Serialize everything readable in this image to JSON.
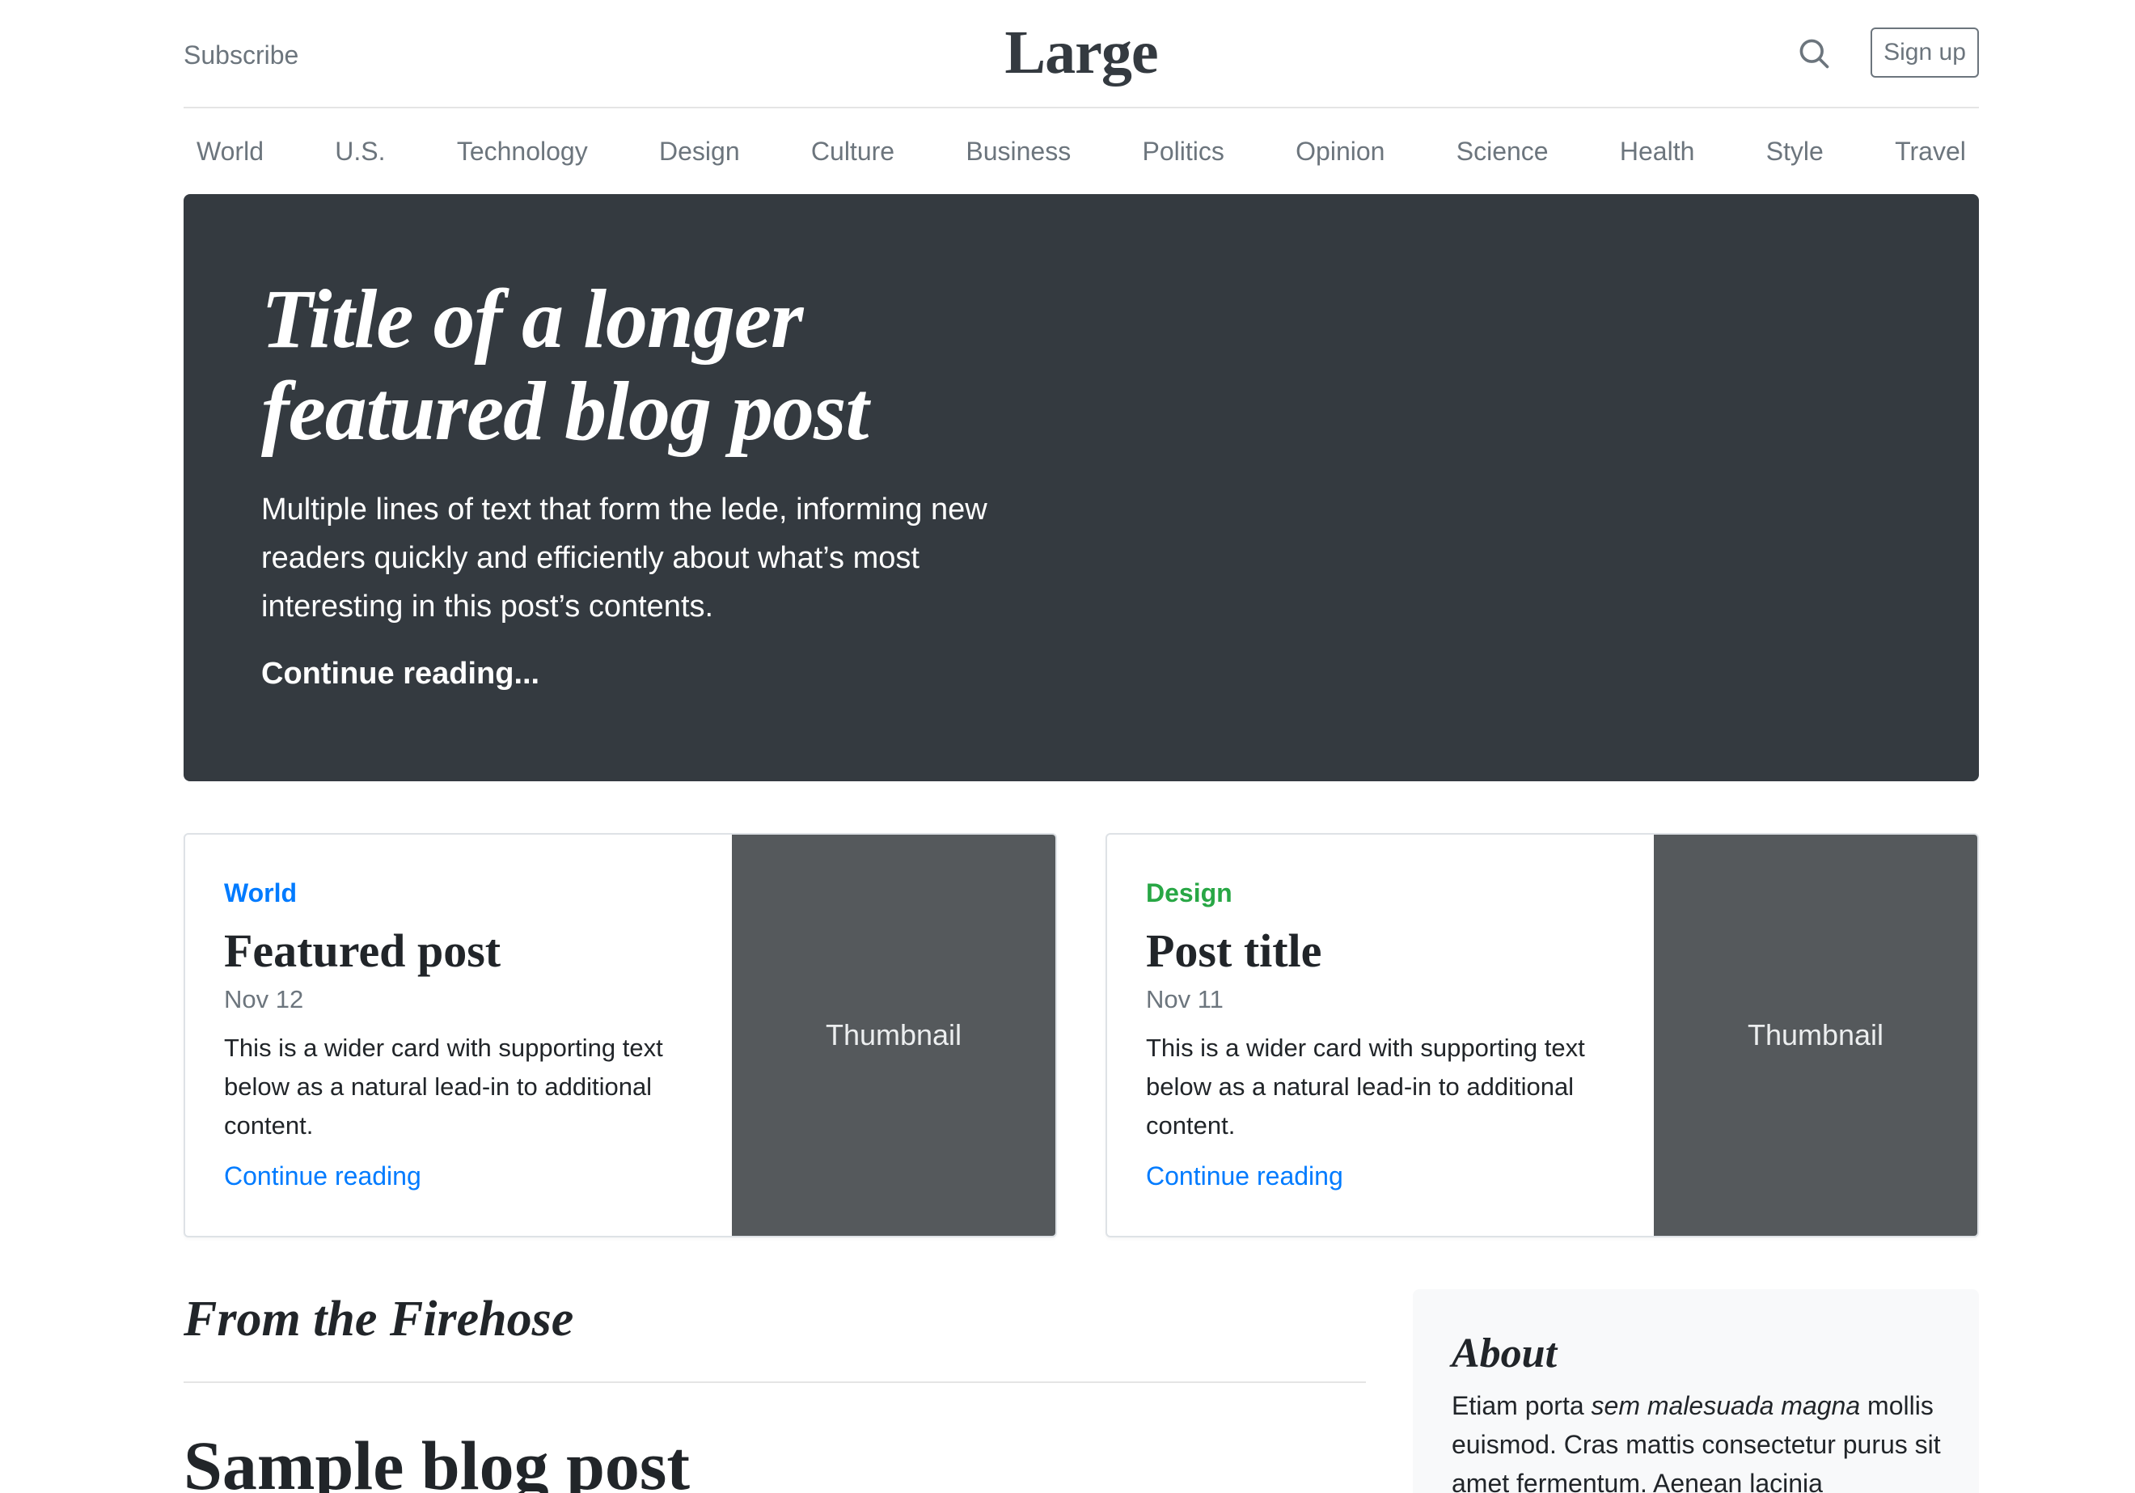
{
  "header": {
    "subscribe_label": "Subscribe",
    "logo": "Large",
    "signup_label": "Sign up"
  },
  "nav": {
    "items": [
      "World",
      "U.S.",
      "Technology",
      "Design",
      "Culture",
      "Business",
      "Politics",
      "Opinion",
      "Science",
      "Health",
      "Style",
      "Travel"
    ]
  },
  "jumbotron": {
    "title": "Title of a longer featured blog post",
    "lede": "Multiple lines of text that form the lede, informing new readers quickly and efficiently about what’s most interesting in this post’s contents.",
    "continue_label": "Continue reading..."
  },
  "cards": [
    {
      "category": "World",
      "category_color": "#007bff",
      "title": "Featured post",
      "date": "Nov 12",
      "text": "This is a wider card with supporting text below as a natural lead-in to additional content.",
      "link": "Continue reading",
      "thumbnail": "Thumbnail"
    },
    {
      "category": "Design",
      "category_color": "#28a745",
      "title": "Post title",
      "date": "Nov 11",
      "text": "This is a wider card with supporting text below as a natural lead-in to additional content.",
      "link": "Continue reading",
      "thumbnail": "Thumbnail"
    }
  ],
  "firehose": {
    "heading": "From the Firehose",
    "post_title": "Sample blog post"
  },
  "about": {
    "heading": "About",
    "text_before": "Etiam porta ",
    "text_em": "sem malesuada magna",
    "text_after": " mollis euismod. Cras mattis consectetur purus sit amet fermentum. Aenean lacinia"
  }
}
